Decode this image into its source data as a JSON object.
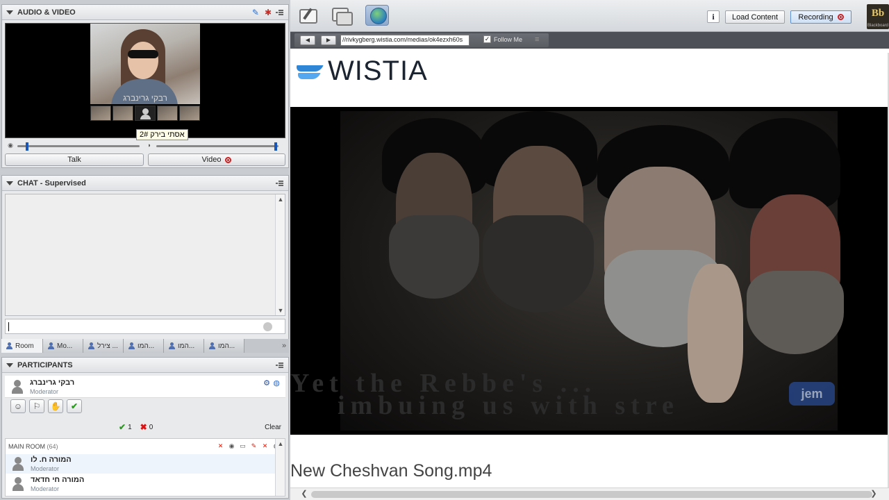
{
  "audio_video": {
    "title": "AUDIO & VIDEO",
    "main_video_name": "רבקי גרינברג",
    "tooltip": "אסתי בירק 2#",
    "talk_label": "Talk",
    "video_label": "Video",
    "mic_level": 0.08,
    "speaker_level": 0.98
  },
  "chat": {
    "title": "CHAT - Supervised",
    "input_value": "",
    "tabs": [
      {
        "label": "Room"
      },
      {
        "label": "Mo..."
      },
      {
        "label": "צירל ..."
      },
      {
        "label": "המו..."
      },
      {
        "label": "המו..."
      },
      {
        "label": "המו..."
      }
    ]
  },
  "participants": {
    "title": "PARTICIPANTS",
    "me": {
      "name": "רבקי גרינברג",
      "role": "Moderator"
    },
    "approve_count": "1",
    "deny_count": "0",
    "clear_label": "Clear",
    "room_label": "MAIN ROOM",
    "room_count": "(64)",
    "list": [
      {
        "name": "המורה ח. לו",
        "role": "Moderator"
      },
      {
        "name": "המורה חי חדאד",
        "role": "Moderator"
      }
    ]
  },
  "toolbar": {
    "info_label": "i",
    "load_content_label": "Load Content",
    "recording_label": "Recording",
    "bb_logo_text": "Bb",
    "bb_logo_sub": "Blackboard"
  },
  "browser": {
    "url": "//rivkygberg.wistia.com/medias/ok4ezxh60s",
    "follow_label": "Follow Me",
    "follow_checked": "✓"
  },
  "page": {
    "brand": "WISTIA",
    "caption_line1": "Yet the Rebbe's ...",
    "caption_line2": "imbuing us with stre",
    "channel_logo": "jem",
    "video_title": "New Cheshvan Song.mp4"
  },
  "colors": {
    "accent_blue": "#1a55b8",
    "record_red": "#d51d1d",
    "approve_green": "#2a9a1f",
    "wistia_blue": "#2f85d6"
  }
}
